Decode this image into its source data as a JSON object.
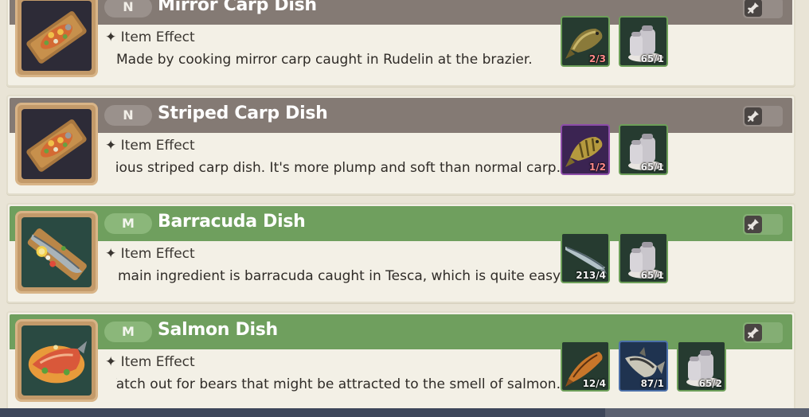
{
  "cards": [
    {
      "grade": "N",
      "title": "Mirror Carp Dish",
      "effect_label": "Item Effect",
      "description": "Made by cooking mirror carp caught in Rudelin at the brazier.",
      "materials": [
        {
          "icon": "mirror-carp-icon",
          "count": "2/3"
        },
        {
          "icon": "salt-pepper-shaker-icon",
          "count": "65/1"
        }
      ]
    },
    {
      "grade": "N",
      "title": "Striped Carp Dish",
      "effect_label": "Item Effect",
      "description": "delicious striped carp dish. It's more plump and soft than normal carp.",
      "materials": [
        {
          "icon": "striped-carp-icon",
          "count": "1/2"
        },
        {
          "icon": "salt-pepper-shaker-icon",
          "count": "65/1"
        }
      ]
    },
    {
      "grade": "M",
      "title": "Barracuda Dish",
      "effect_label": "Item Effect",
      "description": "main ingredient is barracuda caught in Tesca, which is quite easy to d",
      "materials": [
        {
          "icon": "barracuda-icon",
          "count": "213/4"
        },
        {
          "icon": "salt-pepper-shaker-icon",
          "count": "65/1"
        }
      ]
    },
    {
      "grade": "M",
      "title": "Salmon Dish",
      "effect_label": "Item Effect",
      "description": "sh. Watch out for bears that might be attracted to the smell of salmon.",
      "materials": [
        {
          "icon": "salmon-icon",
          "count": "12/4"
        },
        {
          "icon": "tuna-icon",
          "count": "87/1"
        },
        {
          "icon": "salt-pepper-shaker-icon",
          "count": "65/2"
        }
      ]
    }
  ]
}
